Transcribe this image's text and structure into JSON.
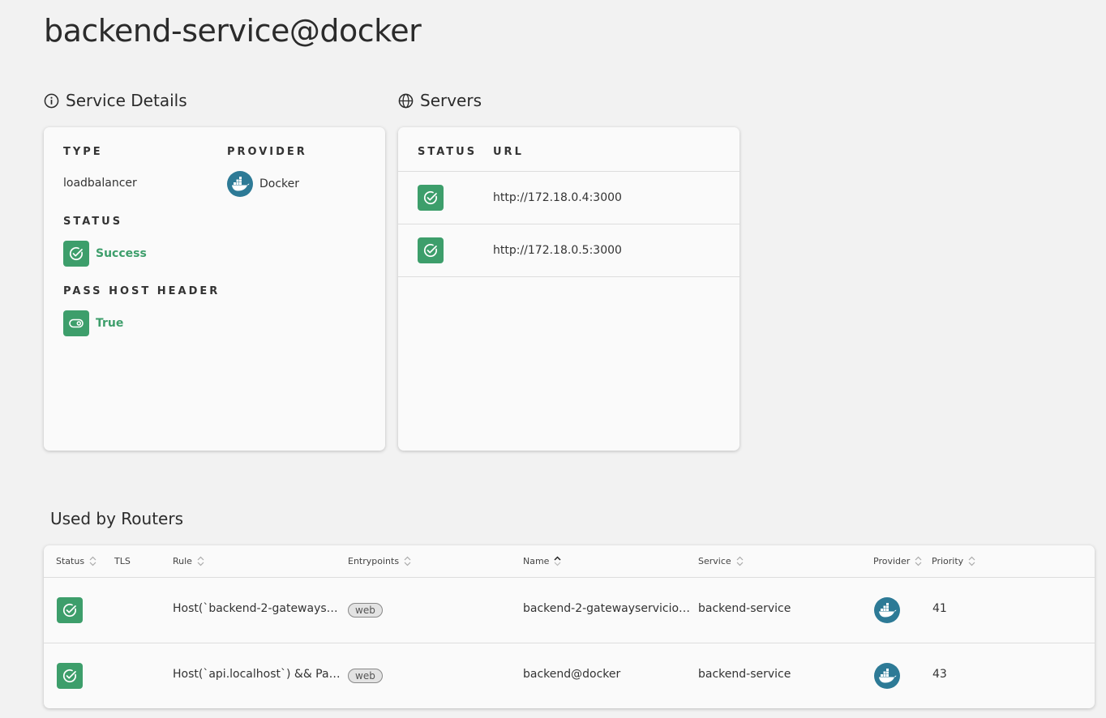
{
  "page": {
    "title": "backend-service@docker"
  },
  "service_details": {
    "heading": "Service Details",
    "type_label": "TYPE",
    "type_value": "loadbalancer",
    "provider_label": "PROVIDER",
    "provider_value": "Docker",
    "status_label": "STATUS",
    "status_value": "Success",
    "pass_host_header_label": "PASS HOST HEADER",
    "pass_host_header_value": "True"
  },
  "servers": {
    "heading": "Servers",
    "columns": {
      "status": "STATUS",
      "url": "URL"
    },
    "rows": [
      {
        "status": "ok",
        "url": "http://172.18.0.4:3000"
      },
      {
        "status": "ok",
        "url": "http://172.18.0.5:3000"
      }
    ]
  },
  "routers": {
    "heading": "Used by Routers",
    "columns": {
      "status": "Status",
      "tls": "TLS",
      "rule": "Rule",
      "entrypoints": "Entrypoints",
      "name": "Name",
      "service": "Service",
      "provider": "Provider",
      "priority": "Priority"
    },
    "rows": [
      {
        "status": "ok",
        "tls": "",
        "rule": "Host(`backend-2-gateways…",
        "entrypoint": "web",
        "name": "backend-2-gatewayservicio…",
        "service": "backend-service",
        "provider": "docker",
        "priority": "41"
      },
      {
        "status": "ok",
        "tls": "",
        "rule": "Host(`api.localhost`) && Pa…",
        "entrypoint": "web",
        "name": "backend@docker",
        "service": "backend-service",
        "provider": "docker",
        "priority": "43"
      }
    ]
  },
  "colors": {
    "success": "#3d9e6b",
    "docker": "#2d7a96",
    "background": "#f2f2f2"
  }
}
